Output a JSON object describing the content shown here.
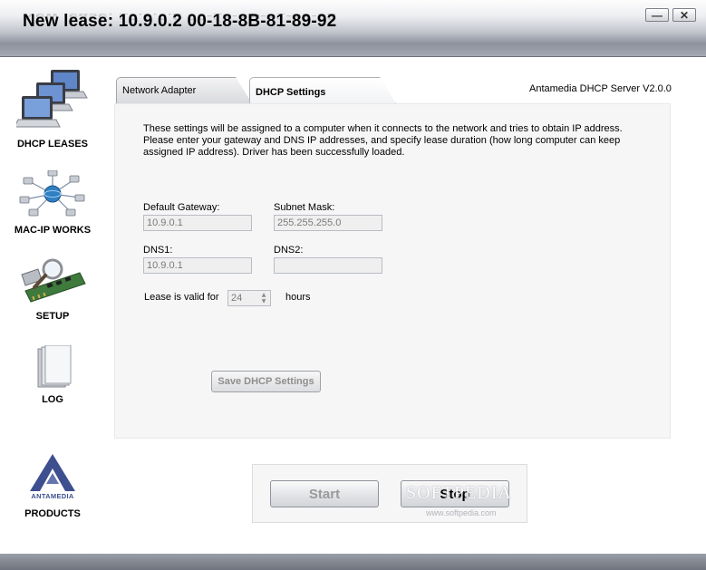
{
  "window": {
    "title": "New lease:  10.9.0.2  00-18-8B-81-89-92",
    "minimize_glyph": "—",
    "close_glyph": "✕"
  },
  "sidebar": {
    "items": [
      {
        "label": "DHCP LEASES",
        "icon": "computers-icon"
      },
      {
        "label": "MAC-IP WORKS",
        "icon": "network-icon"
      },
      {
        "label": "SETUP",
        "icon": "network-card-icon"
      },
      {
        "label": "LOG",
        "icon": "log-icon"
      },
      {
        "label": "PRODUCTS",
        "icon": "antamedia-logo",
        "logo_text": "ANTAMEDIA"
      }
    ]
  },
  "tabs": [
    {
      "label": "Network Adapter",
      "active": false
    },
    {
      "label": "DHCP Settings",
      "active": true
    }
  ],
  "version_label": "Antamedia DHCP Server V2.0.0",
  "dhcp": {
    "description": "These settings will be assigned to a computer when it connects to the network and tries to obtain IP address.\nPlease enter your gateway and DNS IP addresses, and specify lease duration (how long computer can keep\nassigned IP address). Driver has been successfully loaded.",
    "gateway_label": "Default Gateway:",
    "gateway_value": "10.9.0.1",
    "subnet_label": "Subnet Mask:",
    "subnet_value": "255.255.255.0",
    "dns1_label": "DNS1:",
    "dns1_value": "10.9.0.1",
    "dns2_label": "DNS2:",
    "dns2_value": "",
    "lease_label": "Lease is valid for",
    "lease_value": "24",
    "lease_unit": "hours",
    "save_label": "Save DHCP Settings"
  },
  "controls": {
    "start_label": "Start",
    "stop_label": "Stop"
  },
  "watermark": {
    "text": "SOFTPEDIA",
    "url": "www.softpedia.com"
  },
  "colors": {
    "panel_bg": "#f6f6f7",
    "disabled_text": "#9a9a9a",
    "titlebar_dark": "#8e929d",
    "logo_blue": "#3d4f8f"
  }
}
